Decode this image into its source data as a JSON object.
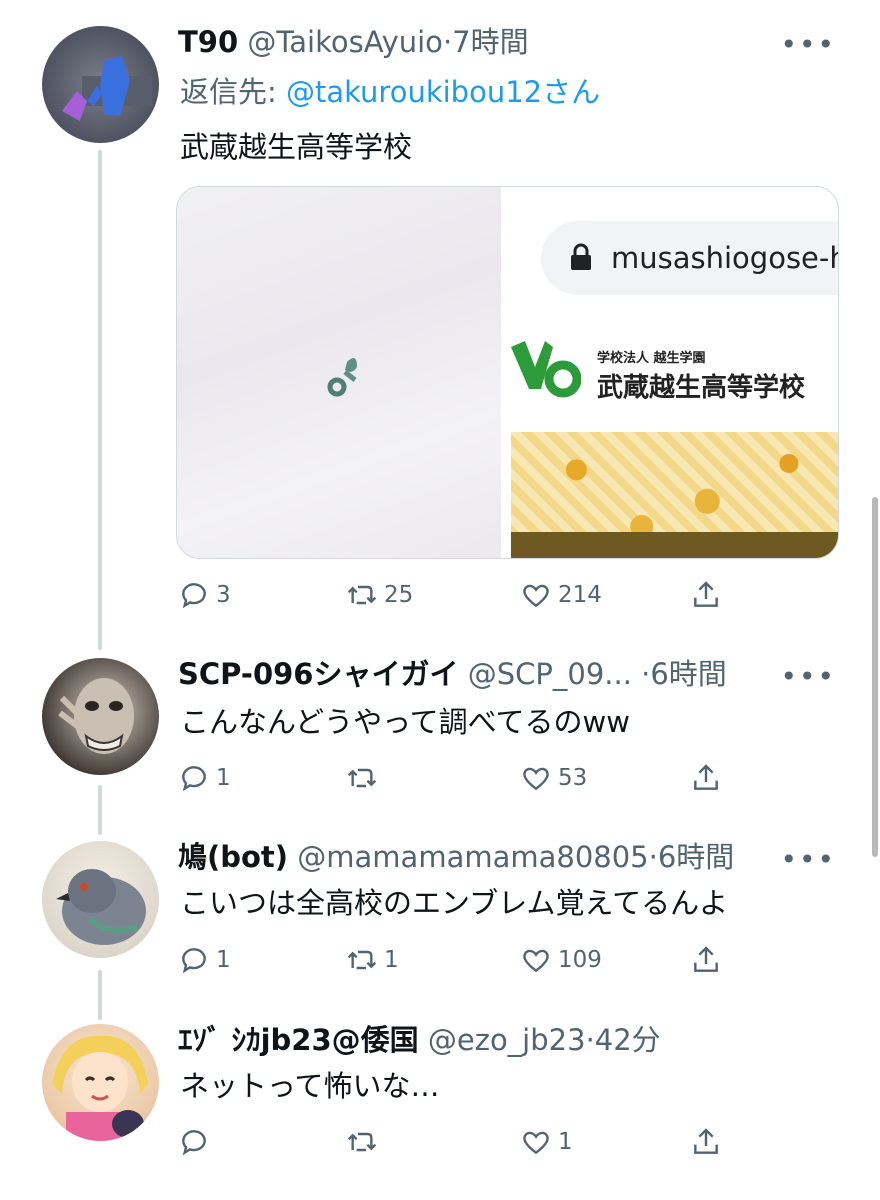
{
  "tweets": [
    {
      "name": "T90",
      "handle": "@TaikosAyuio",
      "dot": "·",
      "time": "7時間",
      "reply_label": "返信先:",
      "reply_mention": "@takuroukibou12さん",
      "text": "武蔵越生高等学校",
      "media": {
        "url": "musashiogose-h",
        "school_sub": "学校法人 越生学園",
        "school_name": "武蔵越生高等学校"
      },
      "replies": "3",
      "retweets": "25",
      "likes": "214"
    },
    {
      "name": "SCP-096シャイガイ",
      "handle": "@SCP_09...",
      "dot": "·",
      "time": "6時間",
      "text": "こんなんどうやって調べてるのww",
      "replies": "1",
      "retweets": "",
      "likes": "53"
    },
    {
      "name": "鳩(bot)",
      "handle": "@mamamamama80805",
      "dot": "·",
      "time": "6時間",
      "text": "こいつは全高校のエンブレム覚えてるんよ",
      "replies": "1",
      "retweets": "1",
      "likes": "109"
    },
    {
      "name": "ｴｿﾞ ｼｶjb23@倭国",
      "handle": "@ezo_jb23",
      "dot": "·",
      "time": "42分",
      "text": "ネットって怖いな…",
      "replies": "",
      "retweets": "",
      "likes": "1"
    }
  ],
  "icons": [
    "reply-icon",
    "retweet-icon",
    "like-icon",
    "share-icon",
    "more-icon",
    "lock-icon"
  ],
  "colors": {
    "accent": "#1d9bf0",
    "muted": "#536471",
    "text": "#0f1419",
    "thread": "#cfd9de"
  }
}
